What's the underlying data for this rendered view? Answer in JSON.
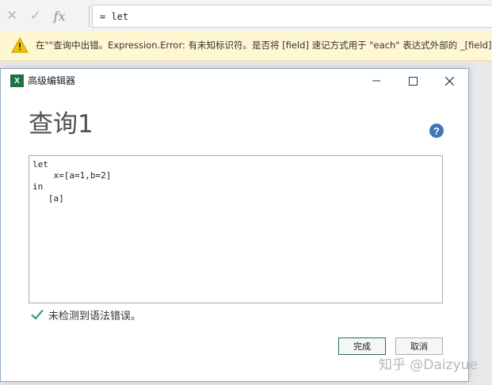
{
  "formula_bar": {
    "cancel_icon": "close-icon",
    "confirm_icon": "check-icon",
    "fx_label": "fx",
    "formula": "= let"
  },
  "error_bar": {
    "icon": "warning-icon",
    "message": "在\"\"查询中出错。Expression.Error: 有未知标识符。是否将 [field] 速记方式用于 \"each\" 表达式外部的 _[field]?"
  },
  "dialog": {
    "title": "高级编辑器",
    "app_icon_letter": "X",
    "heading": "查询1",
    "help_label": "?",
    "code_lines": [
      "let",
      "    x=[a=1,b=2]",
      "in",
      "   [a]"
    ],
    "status_text": "未检测到语法错误。",
    "done_label": "完成",
    "cancel_label": "取消"
  },
  "watermark": "知乎 @Daizyue",
  "colors": {
    "accent_green": "#217346",
    "check_green": "#3f9c6b",
    "help_blue": "#3e78b6",
    "warning_yellow": "#f2c200",
    "error_bar_bg": "#fff7d1"
  }
}
